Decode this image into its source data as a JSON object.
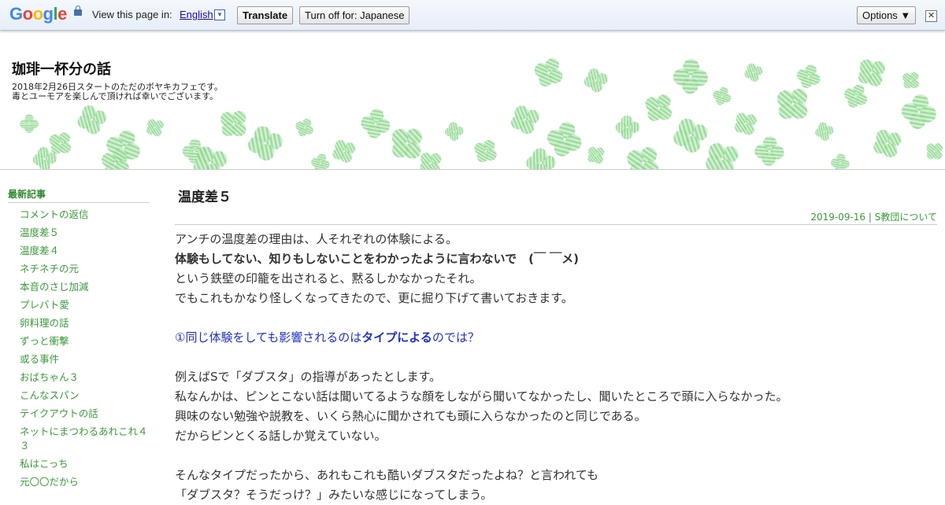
{
  "translate_bar": {
    "logo": "Google",
    "view_text": "View this page in:",
    "language": "English",
    "dropdown_arrow": "▼",
    "translate_button": "Translate",
    "turn_off_button": "Turn off for: Japanese",
    "options_button": "Options ▼",
    "close": "✕",
    "logo_colors": [
      "#4285f4",
      "#ea4335",
      "#fbbc05",
      "#4285f4",
      "#34a853",
      "#ea4335"
    ]
  },
  "header": {
    "title": "珈琲一杯分の話",
    "desc_line1": "2018年2月26日スタートのただのボヤキカフェです。",
    "desc_line2": "毒とユーモアを楽しんで頂ければ幸いでございます。"
  },
  "sidebar": {
    "title": "最新記事",
    "items": [
      "コメントの返信",
      "温度差５",
      "温度差４",
      "ネチネチの元",
      "本音のさじ加減",
      "プレバト愛",
      "卵料理の話",
      "ずっと衝撃",
      "或る事件",
      "おばちゃん３",
      "こんなスパン",
      "テイクアウトの話",
      "ネットにまつわるあれこれ４３",
      "私はこっち",
      "元〇〇だから"
    ]
  },
  "post": {
    "title": "温度差５",
    "meta": "2019-09-16 | S教団について",
    "p1": "アンチの温度差の理由は、人それぞれの体験による。",
    "p2": "体験もしてない、知りもしないことをわかったように言わないで　(￣ ￣メ)",
    "p3": "という鉄壁の印籠を出されると、黙るしかなかったそれ。",
    "p4": "でもこれもかなり怪しくなってきたので、更に掘り下げて書いておきます。",
    "h1_pre": "①同じ体験をしても影響されるのは",
    "h1_bold": "タイプによる",
    "h1_post": "のでは？",
    "p5": "例えばSで「ダブスタ」の指導があったとします。",
    "p6": "私なんかは、ピンとこない話は聞いてるような顔をしながら聞いてなかったし、聞いたところで頭に入らなかった。",
    "p7": "興味のない勉強や説教を、いくら熱心に聞かされても頭に入らなかったのと同じである。",
    "p8": "だからピンとくる話しか覚えていない。",
    "p9": "そんなタイプだったから、あれもこれも酷いダブスタだったよね？と言われても",
    "p10": "「ダブスタ？そうだっけ？」みたいな感じになってしまう。"
  }
}
